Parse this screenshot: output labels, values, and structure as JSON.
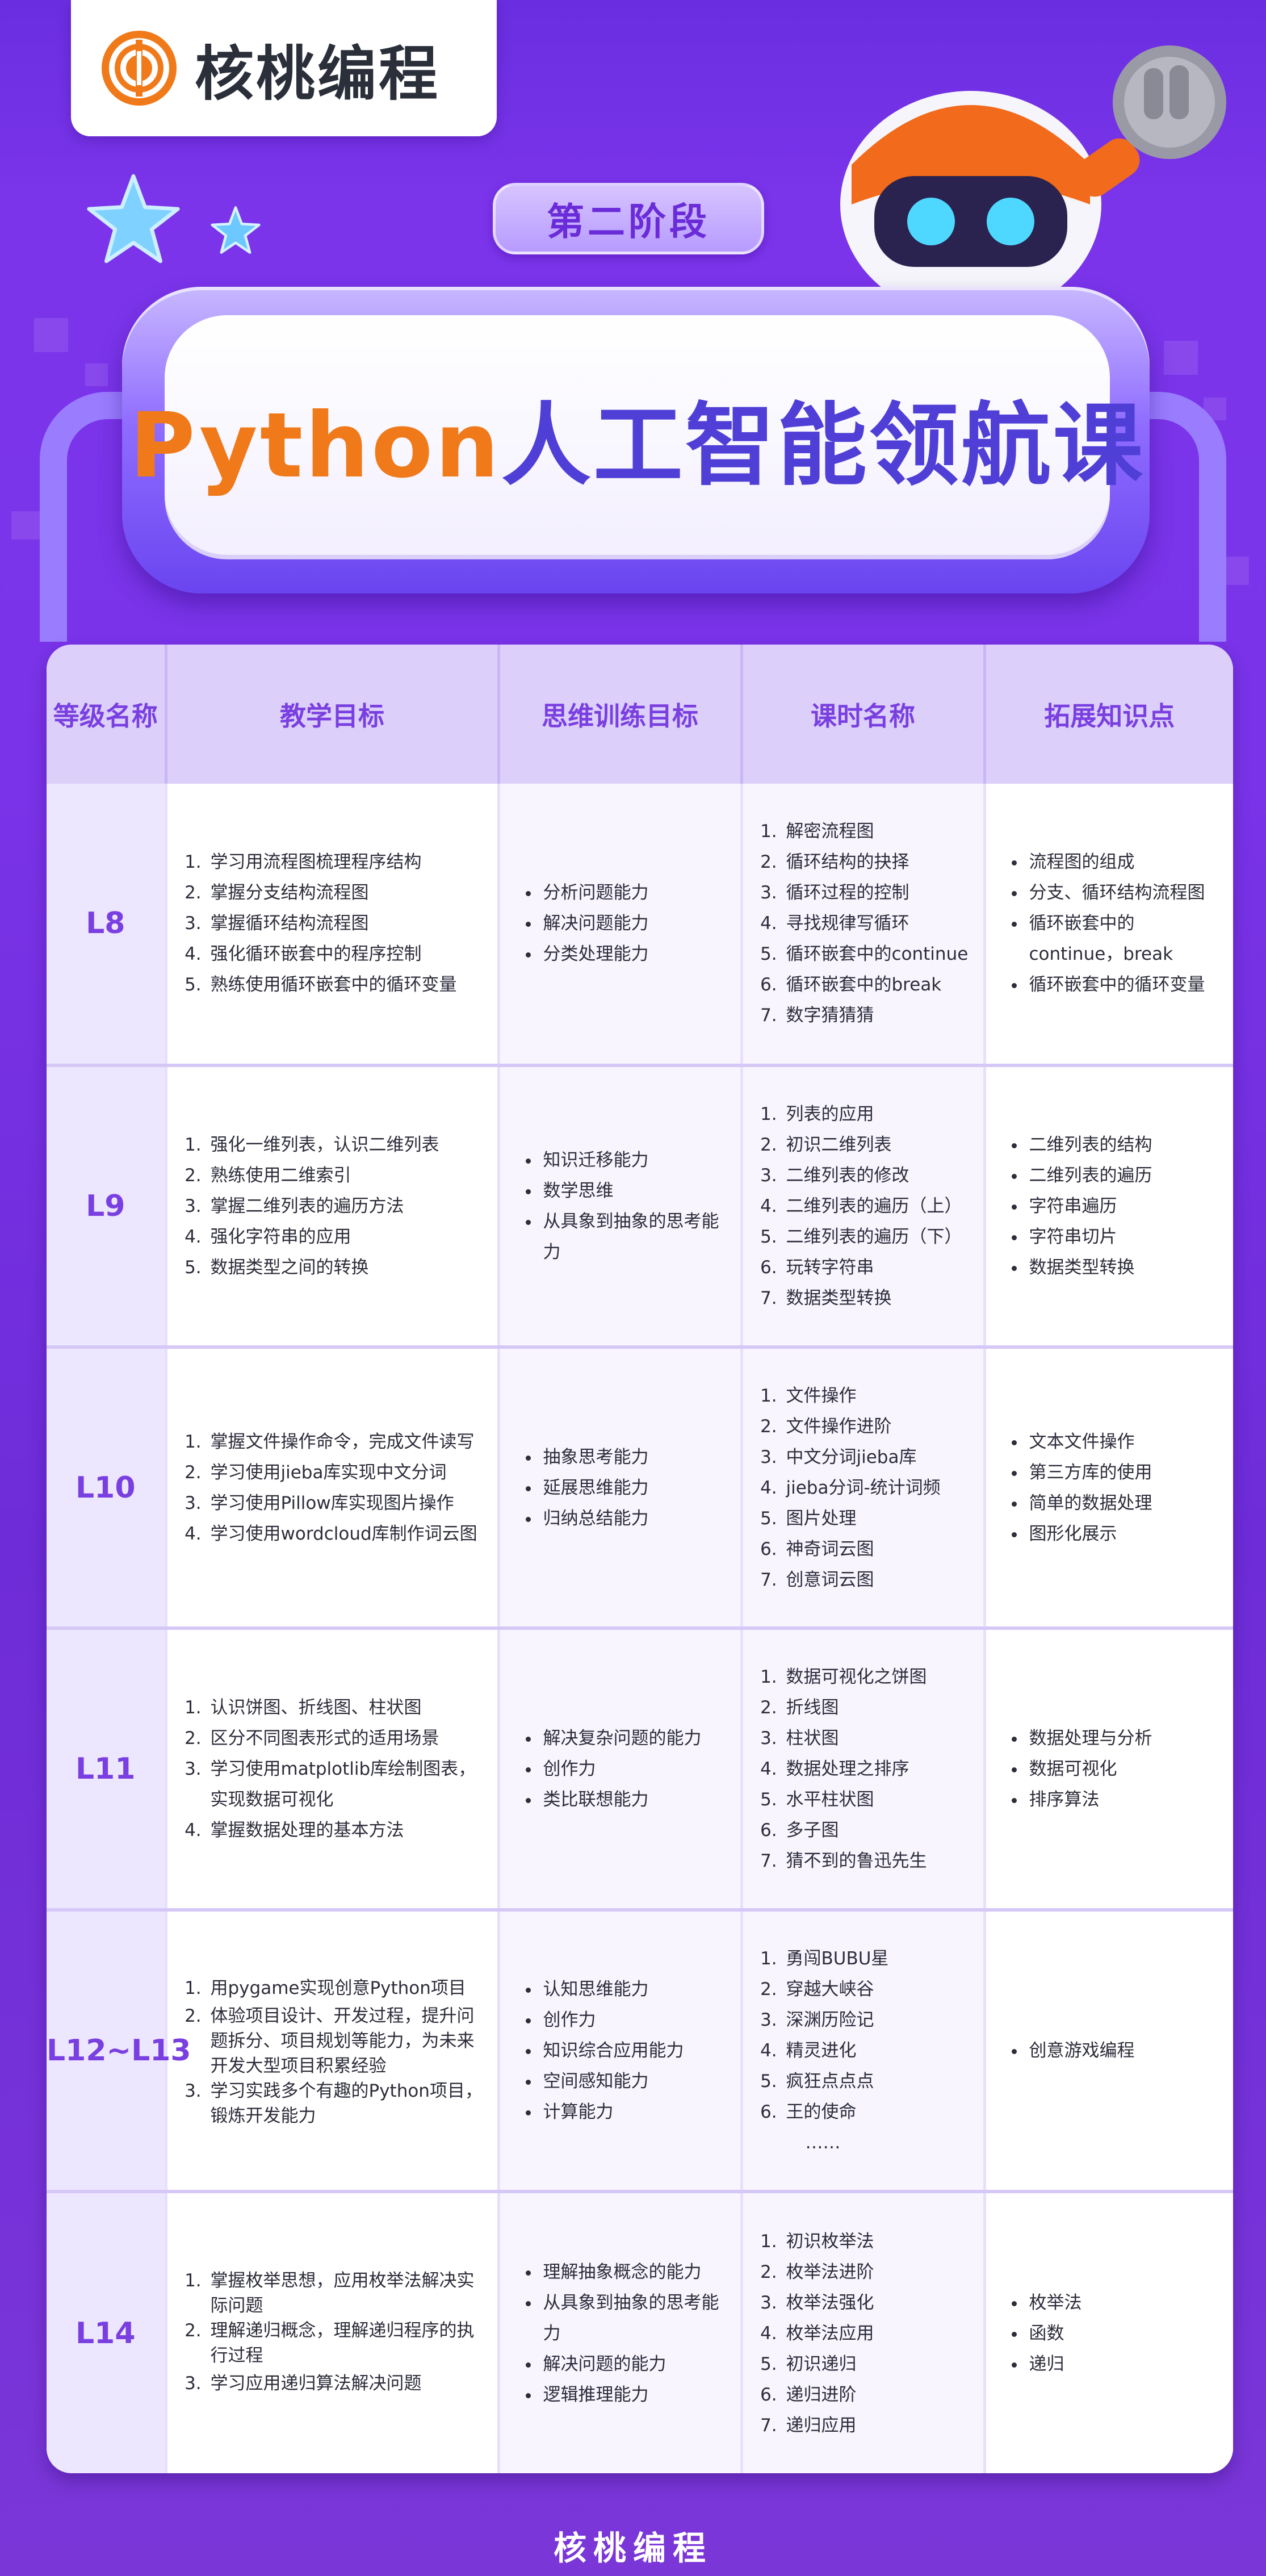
{
  "brand": {
    "logo_text": "核桃编程",
    "accent_orange": "#f07a1a",
    "accent_purple": "#7a3fe0"
  },
  "stage": "第二阶段",
  "title": {
    "python": "Python",
    "rest": "人工智能领航课"
  },
  "table": {
    "headers": [
      "等级名称",
      "教学目标",
      "思维训练目标",
      "课时名称",
      "拓展知识点"
    ],
    "rows": [
      {
        "level": "L8",
        "goals": [
          "学习用流程图梳理程序结构",
          "掌握分支结构流程图",
          "掌握循环结构流程图",
          "强化循环嵌套中的程序控制",
          "熟练使用循环嵌套中的循环变量"
        ],
        "thinking": [
          "分析问题能力",
          "解决问题能力",
          "分类处理能力"
        ],
        "lessons": [
          "解密流程图",
          "循环结构的抉择",
          "循环过程的控制",
          "寻找规律写循环",
          "循环嵌套中的continue",
          "循环嵌套中的break",
          "数字猜猜猜"
        ],
        "extensions": [
          "流程图的组成",
          "分支、循环结构流程图",
          "循环嵌套中的continue，break",
          "循环嵌套中的循环变量"
        ]
      },
      {
        "level": "L9",
        "goals": [
          "强化一维列表，认识二维列表",
          "熟练使用二维索引",
          "掌握二维列表的遍历方法",
          "强化字符串的应用",
          "数据类型之间的转换"
        ],
        "thinking": [
          "知识迁移能力",
          "数学思维",
          "从具象到抽象的思考能力"
        ],
        "lessons": [
          "列表的应用",
          "初识二维列表",
          "二维列表的修改",
          "二维列表的遍历（上）",
          "二维列表的遍历（下）",
          "玩转字符串",
          "数据类型转换"
        ],
        "extensions": [
          "二维列表的结构",
          "二维列表的遍历",
          "字符串遍历",
          "字符串切片",
          "数据类型转换"
        ]
      },
      {
        "level": "L10",
        "goals": [
          "掌握文件操作命令，完成文件读写",
          "学习使用jieba库实现中文分词",
          "学习使用Pillow库实现图片操作",
          "学习使用wordcloud库制作词云图"
        ],
        "thinking": [
          "抽象思考能力",
          "延展思维能力",
          "归纳总结能力"
        ],
        "lessons": [
          "文件操作",
          "文件操作进阶",
          "中文分词jieba库",
          "jieba分词-统计词频",
          "图片处理",
          "神奇词云图",
          "创意词云图"
        ],
        "extensions": [
          "文本文件操作",
          "第三方库的使用",
          "简单的数据处理",
          "图形化展示"
        ]
      },
      {
        "level": "L11",
        "goals": [
          "认识饼图、折线图、柱状图",
          "区分不同图表形式的适用场景",
          "学习使用matplotlib库绘制图表，实现数据可视化",
          "掌握数据处理的基本方法"
        ],
        "thinking": [
          "解决复杂问题的能力",
          "创作力",
          "类比联想能力"
        ],
        "lessons": [
          "数据可视化之饼图",
          "折线图",
          "柱状图",
          "数据处理之排序",
          "水平柱状图",
          "多子图",
          "猜不到的鲁迅先生"
        ],
        "extensions": [
          "数据处理与分析",
          "数据可视化",
          "排序算法"
        ]
      },
      {
        "level": "L12~L13",
        "goals": [
          "用pygame实现创意Python项目",
          "体验项目设计、开发过程，提升问题拆分、项目规划等能力，为未来开发大型项目积累经验",
          "学习实践多个有趣的Python项目，锻炼开发能力"
        ],
        "thinking": [
          "认知思维能力",
          "创作力",
          "知识综合应用能力",
          "空间感知能力",
          "计算能力"
        ],
        "lessons": [
          "勇闯BUBU星",
          "穿越大峡谷",
          "深渊历险记",
          "精灵进化",
          "疯狂点点点",
          "王的使命"
        ],
        "lessons_more": "……",
        "extensions": [
          "创意游戏编程"
        ]
      },
      {
        "level": "L14",
        "goals": [
          "掌握枚举思想，应用枚举法解决实际问题",
          "理解递归概念，理解递归程序的执行过程",
          "学习应用递归算法解决问题"
        ],
        "thinking": [
          "理解抽象概念的能力",
          "从具象到抽象的思考能力",
          "解决问题的能力",
          "逻辑推理能力"
        ],
        "lessons": [
          "初识枚举法",
          "枚举法进阶",
          "枚举法强化",
          "枚举法应用",
          "初识递归",
          "递归进阶",
          "递归应用"
        ],
        "extensions": [
          "枚举法",
          "函数",
          "递归"
        ]
      }
    ]
  },
  "footer": "核桃编程"
}
